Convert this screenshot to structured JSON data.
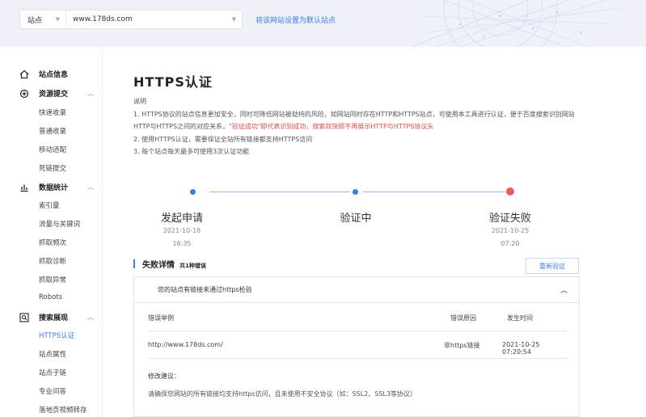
{
  "topbar": {
    "site_type": "站点",
    "site_domain": "www.178ds.com",
    "default_link": "将该网站设置为默认站点"
  },
  "sidebar": {
    "sections": [
      {
        "label": "站点信息",
        "icon": "home-icon",
        "items": []
      },
      {
        "label": "资源提交",
        "icon": "submit-icon",
        "items": [
          "快速收录",
          "普通收录",
          "移动适配",
          "死链提交"
        ]
      },
      {
        "label": "数据统计",
        "icon": "chart-icon",
        "items": [
          "索引量",
          "流量与关键词",
          "抓取频次",
          "抓取诊断",
          "抓取异常",
          "Robots"
        ]
      },
      {
        "label": "搜索展现",
        "icon": "search-display-icon",
        "items": [
          "HTTPS认证",
          "站点属性",
          "站点子链",
          "专业问答",
          "落地页视频转存"
        ]
      }
    ],
    "active_item": "HTTPS认证"
  },
  "page": {
    "title": "HTTPS认证",
    "desc_heading": "说明",
    "desc_line1": "1. HTTPS协议的站点信息更加安全，同时可降低网站被劫持的风险，如网站同时存在HTTP和HTTPS站点，可使用本工具进行认证，便于百度搜索识别网站",
    "desc_line2a": "HTTP与HTTPS之间的对应关系，",
    "desc_line2b": "\"验证成功\"即代表识别成功，搜索就快照不再展示HTTP与HTTPS协议头",
    "desc_line3": "2. 使用HTTPS认证，需要保证全站所有链接都支持HTTPS访问",
    "desc_line4": "3. 每个站点每天最多可使用3次认证功能"
  },
  "steps": [
    {
      "label": "发起申请",
      "date": "2021-10-18",
      "time": "16:35",
      "status": "done"
    },
    {
      "label": "验证中",
      "date": "",
      "time": "",
      "status": "done"
    },
    {
      "label": "验证失败",
      "date": "2021-10-25",
      "time": "07:20",
      "status": "fail"
    }
  ],
  "detail": {
    "title": "失败详情",
    "count": "共1种错误",
    "reverify_button": "重新验证",
    "panel_head": "您的站点有链接未通过https检验",
    "col_example": "错误举例",
    "col_reason": "错误原因",
    "col_time": "发生时间",
    "row_url": "http://www.178ds.com/",
    "row_reason": "非https链接",
    "row_time": "2021-10-25 07:20:54",
    "suggestion_title": "修改建议：",
    "suggestion_text": "请确保您网站的所有链接均支持https访问，且未使用不安全协议（如：SSL2、SSL3等协议）"
  },
  "colors": {
    "accent": "#3c7be8",
    "fail": "#f05b5b",
    "warn_text": "#e94b4b"
  }
}
